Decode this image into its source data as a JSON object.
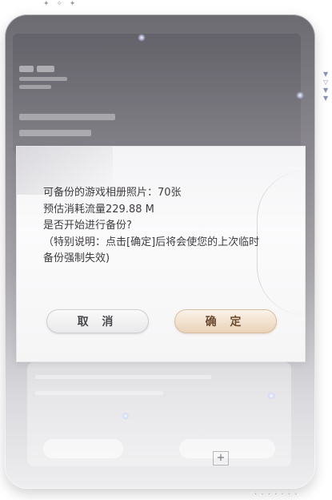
{
  "dialog": {
    "message_lines": [
      "可备份的游戏相册照片：70张",
      "预估消耗流量229.88 M",
      "是否开始进行备份?",
      "（特别说明：点击[确定]后将会使您的上次临时",
      "备份强制失效)"
    ],
    "cancel_label": "取 消",
    "confirm_label": "确 定"
  },
  "decor": {
    "sparkles": "✦ ✧ ✦",
    "side_arrows": [
      "▼",
      "▽",
      "▼",
      "▼"
    ],
    "dots": "· · · · · · ·"
  },
  "colors": {
    "confirm_accent": "#ead2b8",
    "cancel_accent": "#e9e9eb",
    "text": "#3f3c40"
  }
}
